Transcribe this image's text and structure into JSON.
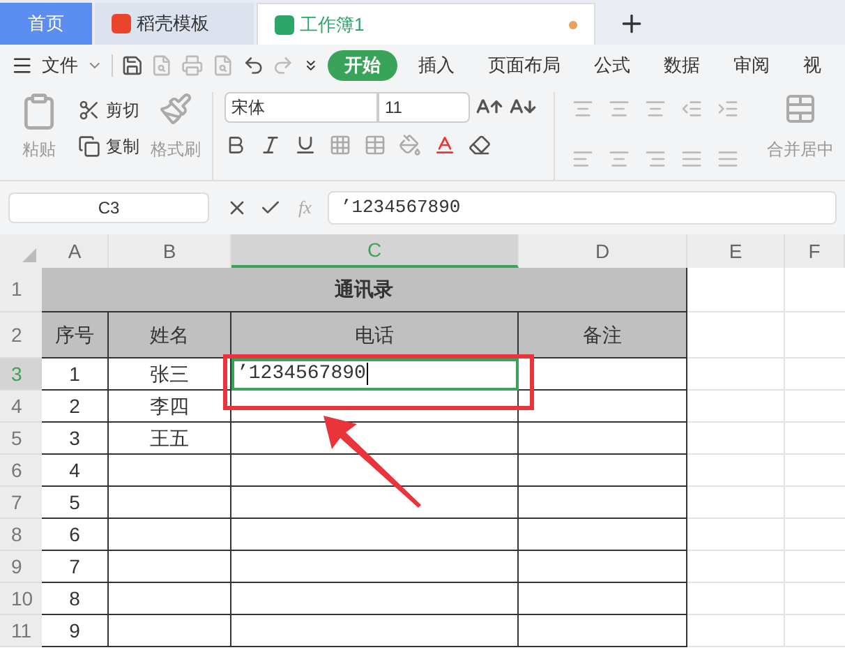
{
  "tabs": [
    {
      "label": "首页",
      "kind": "home",
      "selected": false,
      "modified": false
    },
    {
      "label": "稻壳模板",
      "kind": "docer",
      "selected": false,
      "modified": false
    },
    {
      "label": "工作簿1",
      "kind": "sheet",
      "selected": true,
      "modified": true
    }
  ],
  "menu": {
    "file": "文件",
    "tabs": [
      {
        "label": "开始",
        "selected": true
      },
      {
        "label": "插入",
        "selected": false
      },
      {
        "label": "页面布局",
        "selected": false
      },
      {
        "label": "公式",
        "selected": false
      },
      {
        "label": "数据",
        "selected": false
      },
      {
        "label": "审阅",
        "selected": false
      },
      {
        "label": "视",
        "selected": false
      }
    ]
  },
  "ribbon": {
    "paste": "粘贴",
    "cut": "剪切",
    "copy": "复制",
    "format_painter": "格式刷",
    "font_name": "宋体",
    "font_size": "11",
    "merge": "合并居中"
  },
  "formula_bar": {
    "name_box": "C3",
    "function": "fx",
    "content": "’1234567890"
  },
  "sheet": {
    "columns": [
      {
        "label": "A",
        "selected": false
      },
      {
        "label": "B",
        "selected": false
      },
      {
        "label": "C",
        "selected": true
      },
      {
        "label": "D",
        "selected": false
      },
      {
        "label": "E",
        "selected": false
      },
      {
        "label": "F",
        "selected": false
      }
    ],
    "rows": [
      {
        "number": "1",
        "kind": "title",
        "selected": false,
        "title": "通讯录"
      },
      {
        "number": "2",
        "kind": "header",
        "selected": false,
        "cells": {
          "a": "序号",
          "b": "姓名",
          "c": "电话",
          "d": "备注"
        }
      },
      {
        "number": "3",
        "kind": "data",
        "selected": true,
        "cells": {
          "a": "1",
          "b": "张三",
          "c": "’1234567890"
        }
      },
      {
        "number": "4",
        "kind": "data",
        "selected": false,
        "cells": {
          "a": "2",
          "b": "李四"
        }
      },
      {
        "number": "5",
        "kind": "data",
        "selected": false,
        "cells": {
          "a": "3",
          "b": "王五"
        }
      },
      {
        "number": "6",
        "kind": "data",
        "selected": false,
        "cells": {
          "a": "4"
        }
      },
      {
        "number": "7",
        "kind": "data",
        "selected": false,
        "cells": {
          "a": "5"
        }
      },
      {
        "number": "8",
        "kind": "data",
        "selected": false,
        "cells": {
          "a": "6"
        }
      },
      {
        "number": "9",
        "kind": "data",
        "selected": false,
        "cells": {
          "a": "7"
        }
      },
      {
        "number": "10",
        "kind": "data",
        "selected": false,
        "cells": {
          "a": "8"
        }
      },
      {
        "number": "11",
        "kind": "data",
        "selected": false,
        "cells": {
          "a": "9"
        }
      }
    ]
  }
}
